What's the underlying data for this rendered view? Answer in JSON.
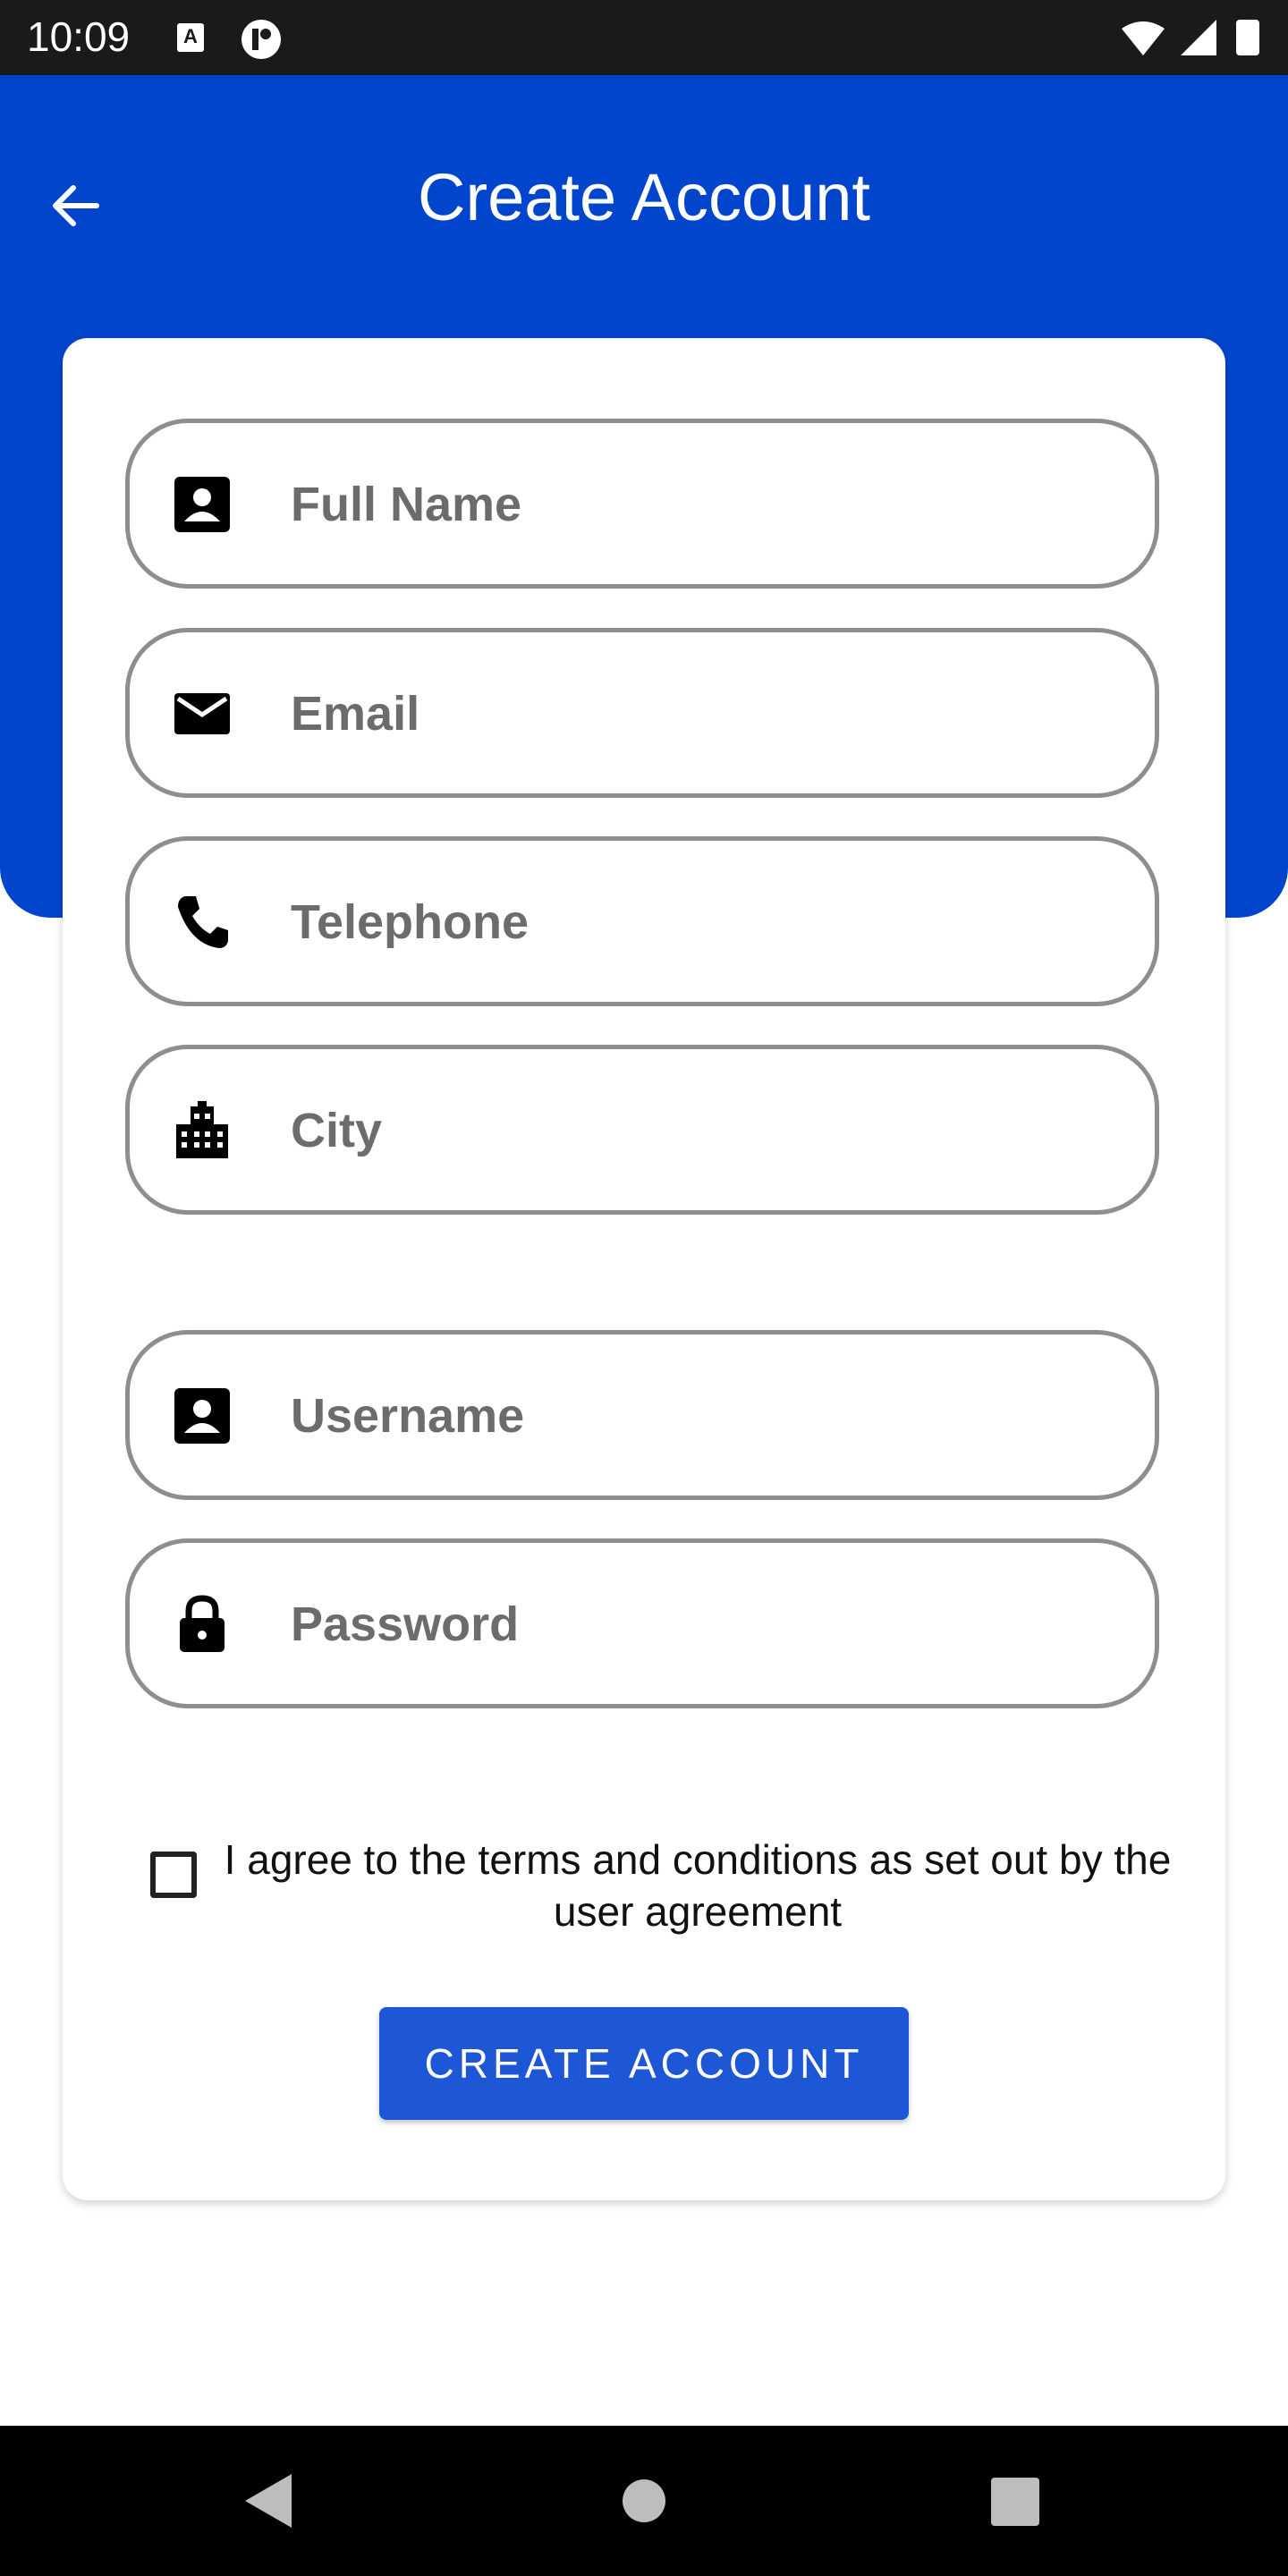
{
  "status_bar": {
    "time": "10:09",
    "a_icon_text": "A"
  },
  "header": {
    "title": "Create Account"
  },
  "form": {
    "full_name": {
      "placeholder": "Full Name",
      "value": ""
    },
    "email": {
      "placeholder": "Email",
      "value": ""
    },
    "telephone": {
      "placeholder": "Telephone",
      "value": ""
    },
    "city": {
      "placeholder": "City",
      "value": ""
    },
    "username": {
      "placeholder": "Username",
      "value": ""
    },
    "password": {
      "placeholder": "Password",
      "value": ""
    }
  },
  "terms": {
    "label": "I agree to the terms and conditions as set out by the user agreement",
    "checked": false
  },
  "actions": {
    "create_account_label": "CREATE ACCOUNT"
  },
  "colors": {
    "header_blue": "#0045cc",
    "button_blue": "#1e57d6",
    "field_border": "#8e8e8e"
  }
}
